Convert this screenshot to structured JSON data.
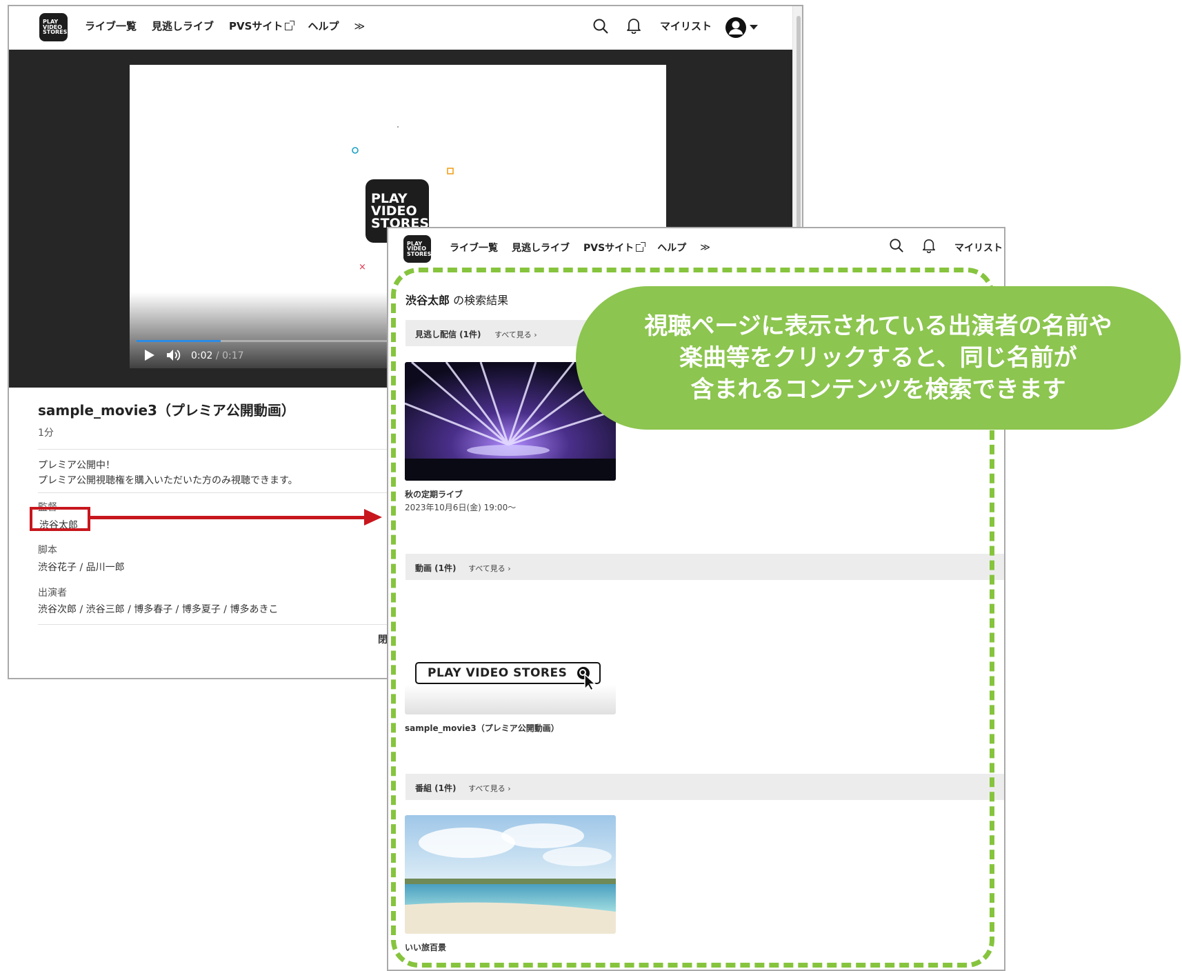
{
  "nav": {
    "logo_lines": [
      "PLAY",
      "VIDEO",
      "STORES"
    ],
    "items": [
      "ライブ一覧",
      "見逃しライブ",
      "PVSサイト",
      "ヘルプ"
    ],
    "more": "≫",
    "mylist": "マイリスト"
  },
  "player": {
    "splash_logo_lines": [
      "PLAY",
      "VIDEO",
      "STORES"
    ],
    "time_current": "0:02",
    "time_sep": " / ",
    "time_total": "0:17",
    "progress": 0.16
  },
  "video": {
    "title": "sample_movie3（プレミア公開動画）",
    "duration": "1分",
    "description_lines": [
      "プレミア公開中！",
      "プレミア公開視聴権を購入いただいた方のみ視聴できます。"
    ],
    "credits": [
      {
        "label": "監督",
        "value": "渋谷太郎"
      },
      {
        "label": "脚本",
        "value": "渋谷花子 / 品川一郎"
      },
      {
        "label": "出演者",
        "value": "渋谷次郎 / 渋谷三郎 / 博多春子 / 博多夏子 / 博多あきこ"
      }
    ],
    "close_fragment": "閉"
  },
  "search": {
    "query": "渋谷太郎",
    "suffix": " の検索結果",
    "sections": [
      {
        "label": "見逃し配信 (1件)",
        "see_all": "すべて見る ›",
        "item_title": "秋の定期ライブ",
        "item_date": "2023年10月6日(金) 19:00〜"
      },
      {
        "label": "動画 (1件)",
        "see_all": "すべて見る ›",
        "item_title": "sample_movie3（プレミア公開動画）",
        "thumb_text": "PLAY VIDEO STORES"
      },
      {
        "label": "番組 (1件)",
        "see_all": "すべて見る ›",
        "item_title": "いい旅百景"
      }
    ]
  },
  "callout": {
    "lines": [
      "視聴ページに表示されている出演者の名前や",
      "楽曲等をクリックすると、同じ名前が",
      "含まれるコンテンツを検索できます"
    ]
  },
  "colors": {
    "accent_green": "#8cc54f",
    "dash_green": "#86c43e",
    "highlight_red": "#c8161d",
    "progress_blue": "#2b8be6"
  }
}
